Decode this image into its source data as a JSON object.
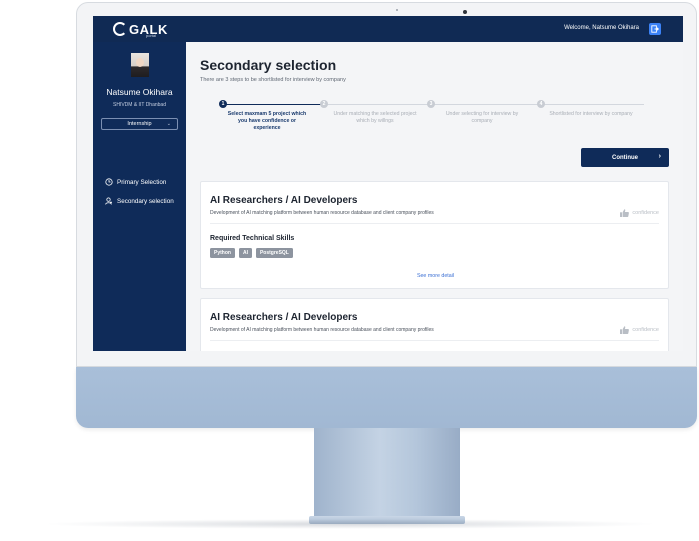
{
  "brand": {
    "logo_text": "GALK",
    "logo_sub": "portal"
  },
  "header": {
    "welcome": "Welcome, Natsume Okihara",
    "logout_icon": "logout-icon"
  },
  "user": {
    "name": "Natsume Okihara",
    "org": "SHIVDM & IIT Dhanbad",
    "role_selected": "Internship"
  },
  "sidebar": {
    "items": [
      {
        "label": "Primary Selection",
        "icon": "clock-icon"
      },
      {
        "label": "Secondary selection",
        "icon": "user-icon"
      }
    ]
  },
  "main": {
    "title": "Secondary selection",
    "subtitle": "There are 3 steps to be shortlisted for interview by company",
    "steps": [
      {
        "number": "1",
        "label": "Select maxmam 5 project which you have confidence or experience",
        "state": "active"
      },
      {
        "number": "2",
        "label": "Under matching the selected project which by willngs",
        "state": "inactive"
      },
      {
        "number": "3",
        "label": "Under selecting for interview by company",
        "state": "inactive"
      },
      {
        "number": "4",
        "label": "Shortlisted for interview by company",
        "state": "inactive"
      }
    ],
    "continue_label": "Continue",
    "projects": [
      {
        "title": "AI Researchers / AI Developers",
        "description": "Development of AI matching platform between human resource database and client company profiles",
        "confidence_label": "confidence",
        "skills_title": "Required Technical Skills",
        "skills": [
          "Python",
          "AI",
          "PostgreSQL"
        ],
        "see_more": "See more detail"
      },
      {
        "title": "AI Researchers / AI Developers",
        "description": "Development of AI matching platform between human resource database and client company profiles",
        "confidence_label": "confidence"
      }
    ]
  },
  "colors": {
    "navy": "#0f2b59",
    "accent_blue": "#3b82f6",
    "link": "#3b6fd4",
    "chip": "#8d949f",
    "monitor_chin": "#a9bfd9"
  }
}
